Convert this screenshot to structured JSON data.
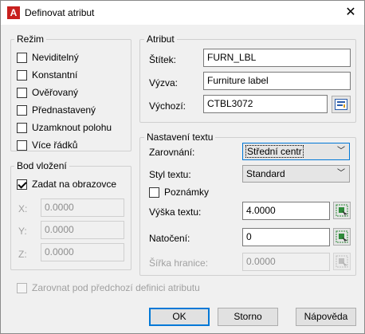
{
  "window": {
    "title": "Definovat atribut",
    "close_glyph": "✕",
    "app_icon_letter": "A"
  },
  "rezim": {
    "label": "Režim",
    "items": [
      {
        "label": "Neviditelný",
        "checked": false
      },
      {
        "label": "Konstantní",
        "checked": false
      },
      {
        "label": "Ověřovaný",
        "checked": false
      },
      {
        "label": "Přednastavený",
        "checked": false
      },
      {
        "label": "Uzamknout polohu",
        "checked": false
      },
      {
        "label": "Více řádků",
        "checked": false
      }
    ]
  },
  "bod_vlozeni": {
    "label": "Bod vložení",
    "zadat_label": "Zadat na obrazovce",
    "zadat_checked": true,
    "x_label": "X:",
    "x_value": "0.0000",
    "y_label": "Y:",
    "y_value": "0.0000",
    "z_label": "Z:",
    "z_value": "0.0000"
  },
  "atribut": {
    "label": "Atribut",
    "stitek_label": "Štítek:",
    "stitek_value": "FURN_LBL",
    "vyzva_label": "Výzva:",
    "vyzva_value": "Furniture label",
    "vychozi_label": "Výchozí:",
    "vychozi_value": "CTBL3072",
    "field_icon": "insert-field-icon"
  },
  "nastaveni_textu": {
    "label": "Nastavení textu",
    "zarovnani_label": "Zarovnání:",
    "zarovnani_value": "Střední centr",
    "styl_label": "Styl textu:",
    "styl_value": "Standard",
    "poznamky_label": "Poznámky",
    "poznamky_checked": false,
    "vyska_label": "Výška textu:",
    "vyska_value": "4.0000",
    "natoceni_label": "Natočení:",
    "natoceni_value": "0",
    "sirka_label": "Šířka hranice:",
    "sirka_value": "0.0000",
    "pick_icon": "pick-point-icon"
  },
  "zarovnat": {
    "label": "Zarovnat pod předchozí definici atributu",
    "checked": false
  },
  "buttons": {
    "ok": "OK",
    "storno": "Storno",
    "napoveda": "Nápověda"
  },
  "colors": {
    "accent": "#0078d7",
    "pick_green": "#2e8b3a",
    "app_red": "#c8201e"
  }
}
